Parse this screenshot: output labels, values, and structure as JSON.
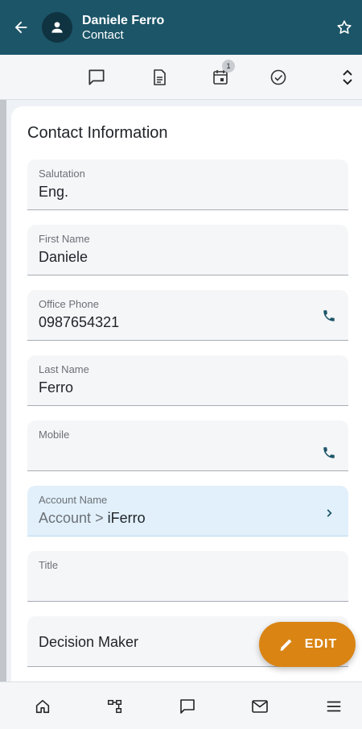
{
  "header": {
    "record_name": "Daniele Ferro",
    "record_type": "Contact",
    "back_icon": "arrow-left-icon",
    "avatar_icon": "person-icon",
    "favorite_icon": "star-outline-icon"
  },
  "actions": {
    "items": [
      {
        "icon": "chat-icon"
      },
      {
        "icon": "document-icon"
      },
      {
        "icon": "calendar-icon",
        "badge": "1"
      },
      {
        "icon": "check-circle-icon"
      },
      {
        "icon": "expand-icon"
      }
    ]
  },
  "section": {
    "title": "Contact Information"
  },
  "fields": {
    "salutation": {
      "label": "Salutation",
      "value": "Eng."
    },
    "first_name": {
      "label": "First Name",
      "value": "Daniele"
    },
    "office_phone": {
      "label": "Office Phone",
      "value": "0987654321"
    },
    "last_name": {
      "label": "Last Name",
      "value": "Ferro"
    },
    "mobile": {
      "label": "Mobile",
      "value": ""
    },
    "account_name": {
      "label": "Account Name",
      "prefix": "Account",
      "separator": ">",
      "value": "iFerro"
    },
    "title": {
      "label": "Title",
      "value": ""
    },
    "decision_maker": {
      "label": "Decision Maker"
    }
  },
  "fab": {
    "label": "EDIT",
    "icon": "pencil-icon"
  },
  "bottom_nav": {
    "items": [
      "home-icon",
      "hierarchy-icon",
      "chat-icon",
      "mail-icon",
      "menu-icon"
    ]
  },
  "colors": {
    "header_bg": "#1c5568",
    "accent": "#d98413",
    "account_highlight": "#e2f0fb"
  }
}
